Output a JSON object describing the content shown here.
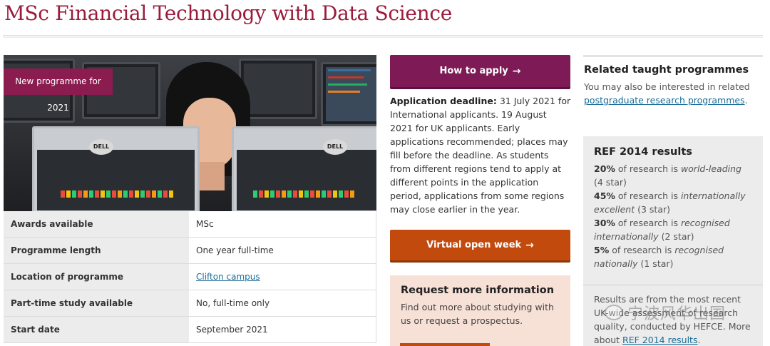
{
  "page": {
    "title": "MSc Financial Technology with Data Science"
  },
  "hero": {
    "badge": "New programme for 2021",
    "monitor_brand": "DELL"
  },
  "facts": [
    {
      "label": "Awards available",
      "value": "MSc"
    },
    {
      "label": "Programme length",
      "value": "One year full-time"
    },
    {
      "label": "Location of programme",
      "value": "Clifton campus"
    },
    {
      "label": "Part-time study available",
      "value": "No, full-time only"
    },
    {
      "label": "Start date",
      "value": "September 2021"
    }
  ],
  "apply": {
    "button_label": "How to apply",
    "arrow": "→"
  },
  "deadline": {
    "heading": "Application deadline:",
    "text": " 31 July 2021 for International applicants. 19 August 2021 for UK applicants. Early applications recommended; places may fill before the deadline. As students from different regions tend to apply at different points in the application period, applications from some regions may close earlier in the year."
  },
  "open_week": {
    "button_label": "Virtual open week",
    "arrow": "→"
  },
  "request_info": {
    "heading": "Request more information",
    "text": "Find out more about studying with us or request a prospectus."
  },
  "related": {
    "heading": "Related taught programmes",
    "text_before": "You may also be interested in related ",
    "link": "postgraduate research programmes",
    "text_after": "."
  },
  "ref": {
    "heading": "REF 2014 results",
    "lines": [
      {
        "pct": "20%",
        "mid": " of research is ",
        "em": "world-leading",
        "tail": " (4 star)"
      },
      {
        "pct": "45%",
        "mid": " of research is ",
        "em": "internationally excellent",
        "tail": " (3 star)"
      },
      {
        "pct": "30%",
        "mid": " of research is ",
        "em": "recognised internationally",
        "tail": " (2 star)"
      },
      {
        "pct": "5%",
        "mid": " of research is ",
        "em": "recognised nationally",
        "tail": " (1 star)"
      }
    ],
    "note_before": "Results are from the most recent UK-wide assessment of research quality, conducted by HEFCE. More about ",
    "note_link": "REF 2014 results",
    "note_after": "."
  },
  "watermark": {
    "text": "宁波风华出国"
  },
  "colors": {
    "title": "#9b1b3d",
    "apply_button": "#7e1a56",
    "open_week_button": "#c24a0c",
    "badge": "#8a1c4f",
    "link": "#1b6d98",
    "info_box": "#f7e0d6",
    "ref_box": "#ececec"
  }
}
